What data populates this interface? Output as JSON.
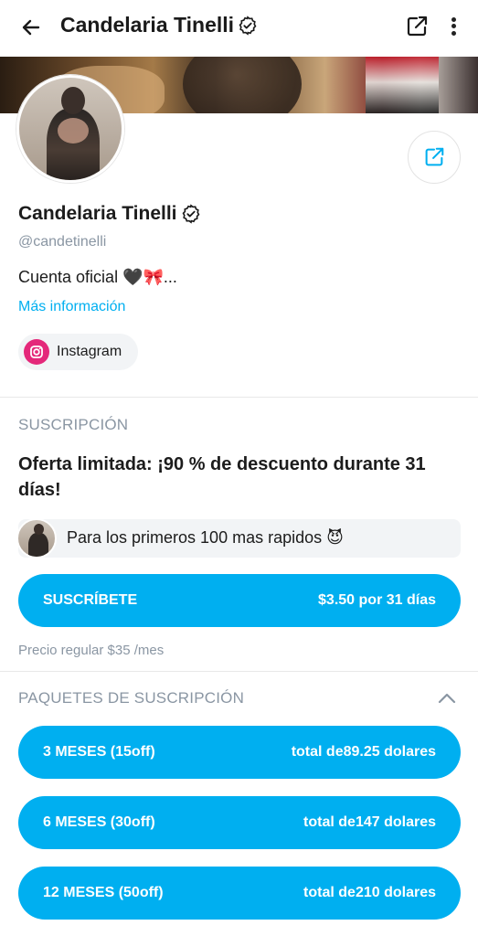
{
  "header": {
    "title": "Candelaria Tinelli",
    "back_icon": "arrow-left-icon",
    "share_icon": "share-icon",
    "more_icon": "more-vertical-icon"
  },
  "profile": {
    "name": "Candelaria Tinelli",
    "handle": "@candetinelli",
    "bio": "Cuenta oficial 🖤🎀...",
    "more_info": "Más información",
    "instagram_label": "Instagram"
  },
  "subscription": {
    "section_title": "SUSCRIPCIÓN",
    "offer_title": "Oferta limitada: ¡90 % de descuento durante 31 días!",
    "promo_message": "Para los primeros 100 mas rapidos 😈",
    "subscribe_label": "SUSCRÍBETE",
    "subscribe_price": "$3.50 por 31 días",
    "regular_price": "Precio regular $35 /mes"
  },
  "bundles": {
    "section_title": "PAQUETES DE SUSCRIPCIÓN",
    "items": [
      {
        "label": "3 MESES (15off)",
        "total": "total de89.25 dolares"
      },
      {
        "label": "6 MESES (30off)",
        "total": "total de147 dolares"
      },
      {
        "label": "12 MESES (50off)",
        "total": "total de210 dolares"
      }
    ]
  },
  "colors": {
    "accent": "#00aff0",
    "muted_text": "#8a96a3",
    "instagram": "#e4287a"
  }
}
